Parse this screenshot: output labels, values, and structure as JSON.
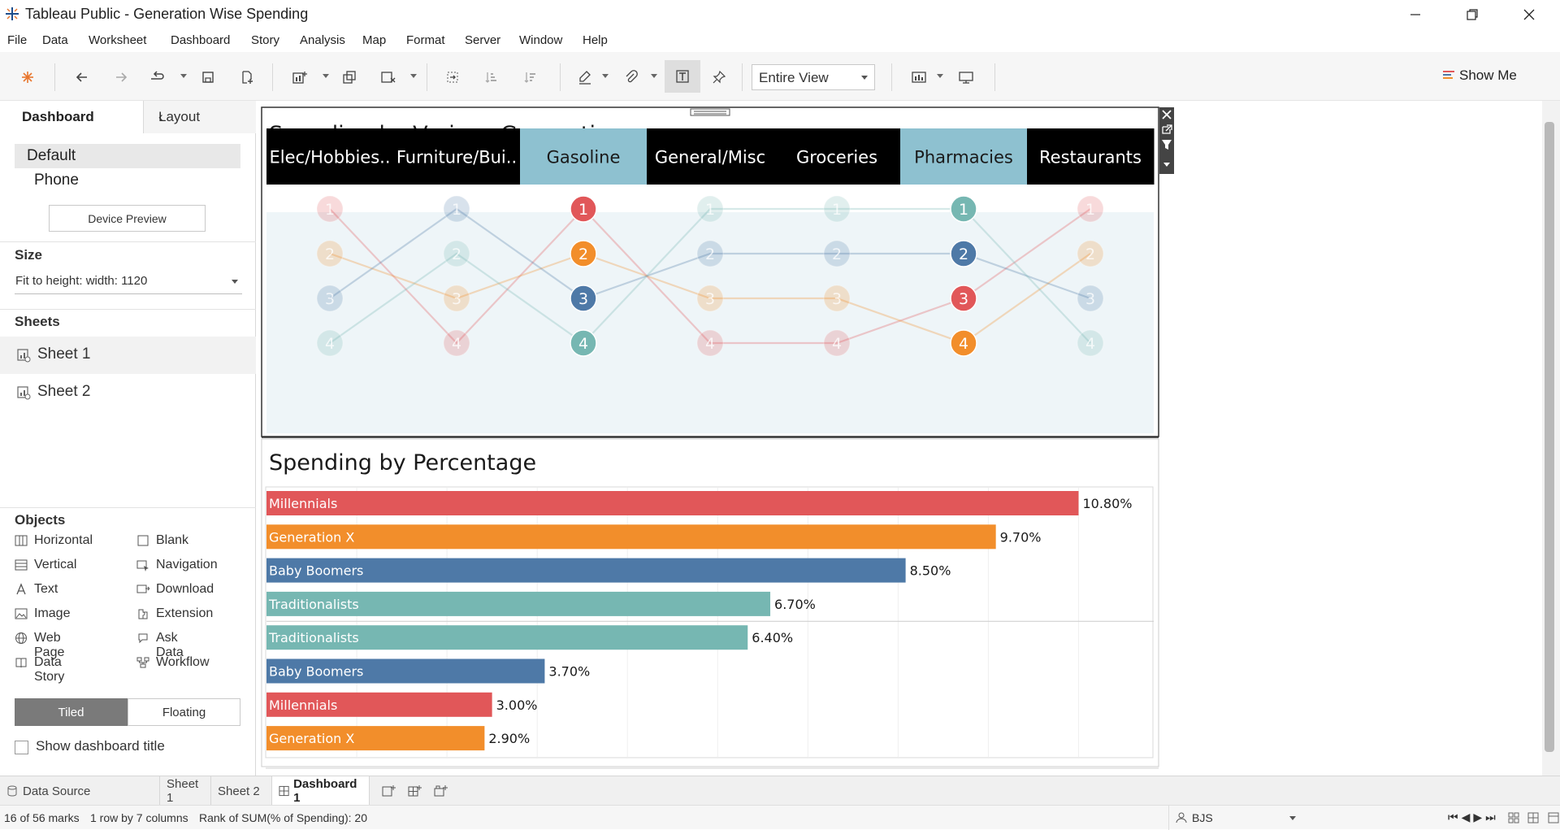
{
  "window": {
    "title": "Tableau Public - Generation Wise Spending"
  },
  "menu": [
    "File",
    "Data",
    "Worksheet",
    "Dashboard",
    "Story",
    "Analysis",
    "Map",
    "Format",
    "Server",
    "Window",
    "Help"
  ],
  "toolbar": {
    "view_select": "Entire View",
    "show_me": "Show Me"
  },
  "left_panel": {
    "tabs": {
      "dashboard": "Dashboard",
      "layout": "Layout"
    },
    "devices": [
      "Default",
      "Phone"
    ],
    "device_preview_label": "Device Preview",
    "size": {
      "heading": "Size",
      "value": "Fit to height: width: 1120"
    },
    "sheets": {
      "heading": "Sheets",
      "items": [
        "Sheet 1",
        "Sheet 2"
      ]
    },
    "objects": {
      "heading": "Objects",
      "items": [
        "Horizontal",
        "Blank",
        "Vertical",
        "Navigation",
        "Text",
        "Download",
        "Image",
        "Extension",
        "Web Page",
        "Ask Data",
        "Data Story",
        "Workflow"
      ]
    },
    "tiled_label": "Tiled",
    "floating_label": "Floating",
    "show_title_label": "Show dashboard title"
  },
  "dashboard": {
    "bump_title": "Spending by Various Generations",
    "bar_title": "Spending by Percentage"
  },
  "colors": {
    "millennials": "#e15759",
    "generation_x": "#f28e2b",
    "baby_boomers": "#4e79a7",
    "traditionalists": "#76b7b2",
    "header_black": "#000000",
    "header_highlight": "#8ec1d0",
    "bump_bg": "#eef5f8"
  },
  "chart_data": [
    {
      "type": "line",
      "title": "Spending by Various Generations",
      "categories": [
        "Elec/Hobbies..",
        "Furniture/Bui..",
        "Gasoline",
        "General/Misc",
        "Groceries",
        "Pharmacies",
        "Restaurants"
      ],
      "highlighted_categories": [
        "Gasoline",
        "Pharmacies"
      ],
      "ylim": [
        1,
        4
      ],
      "series": [
        {
          "color": "#e15759",
          "values": [
            1,
            4,
            1,
            4,
            4,
            3,
            1
          ]
        },
        {
          "color": "#f28e2b",
          "values": [
            2,
            3,
            2,
            3,
            3,
            4,
            2
          ]
        },
        {
          "color": "#4e79a7",
          "values": [
            3,
            1,
            3,
            2,
            2,
            2,
            3
          ]
        },
        {
          "color": "#76b7b2",
          "values": [
            4,
            2,
            4,
            1,
            1,
            1,
            4
          ]
        }
      ]
    },
    {
      "type": "bar",
      "title": "Spending by Percentage",
      "orientation": "horizontal",
      "groups": [
        {
          "items": [
            {
              "label": "Millennials",
              "value": 10.8,
              "value_label": "10.80%",
              "color": "#e15759"
            },
            {
              "label": "Generation X",
              "value": 9.7,
              "value_label": "9.70%",
              "color": "#f28e2b"
            },
            {
              "label": "Baby Boomers",
              "value": 8.5,
              "value_label": "8.50%",
              "color": "#4e79a7"
            },
            {
              "label": "Traditionalists",
              "value": 6.7,
              "value_label": "6.70%",
              "color": "#76b7b2"
            }
          ]
        },
        {
          "items": [
            {
              "label": "Traditionalists",
              "value": 6.4,
              "value_label": "6.40%",
              "color": "#76b7b2"
            },
            {
              "label": "Baby Boomers",
              "value": 3.7,
              "value_label": "3.70%",
              "color": "#4e79a7"
            },
            {
              "label": "Millennials",
              "value": 3.0,
              "value_label": "3.00%",
              "color": "#e15759"
            },
            {
              "label": "Generation X",
              "value": 2.9,
              "value_label": "2.90%",
              "color": "#f28e2b"
            }
          ]
        }
      ],
      "xlim": [
        0,
        11.8
      ],
      "grid": true
    }
  ],
  "bottom_tabs": [
    "Data Source",
    "Sheet 1",
    "Sheet 2",
    "Dashboard 1"
  ],
  "status": {
    "marks": "16 of 56 marks",
    "layout": "1 row by 7 columns",
    "info": "Rank of SUM(% of Spending): 20",
    "user": "BJS"
  }
}
